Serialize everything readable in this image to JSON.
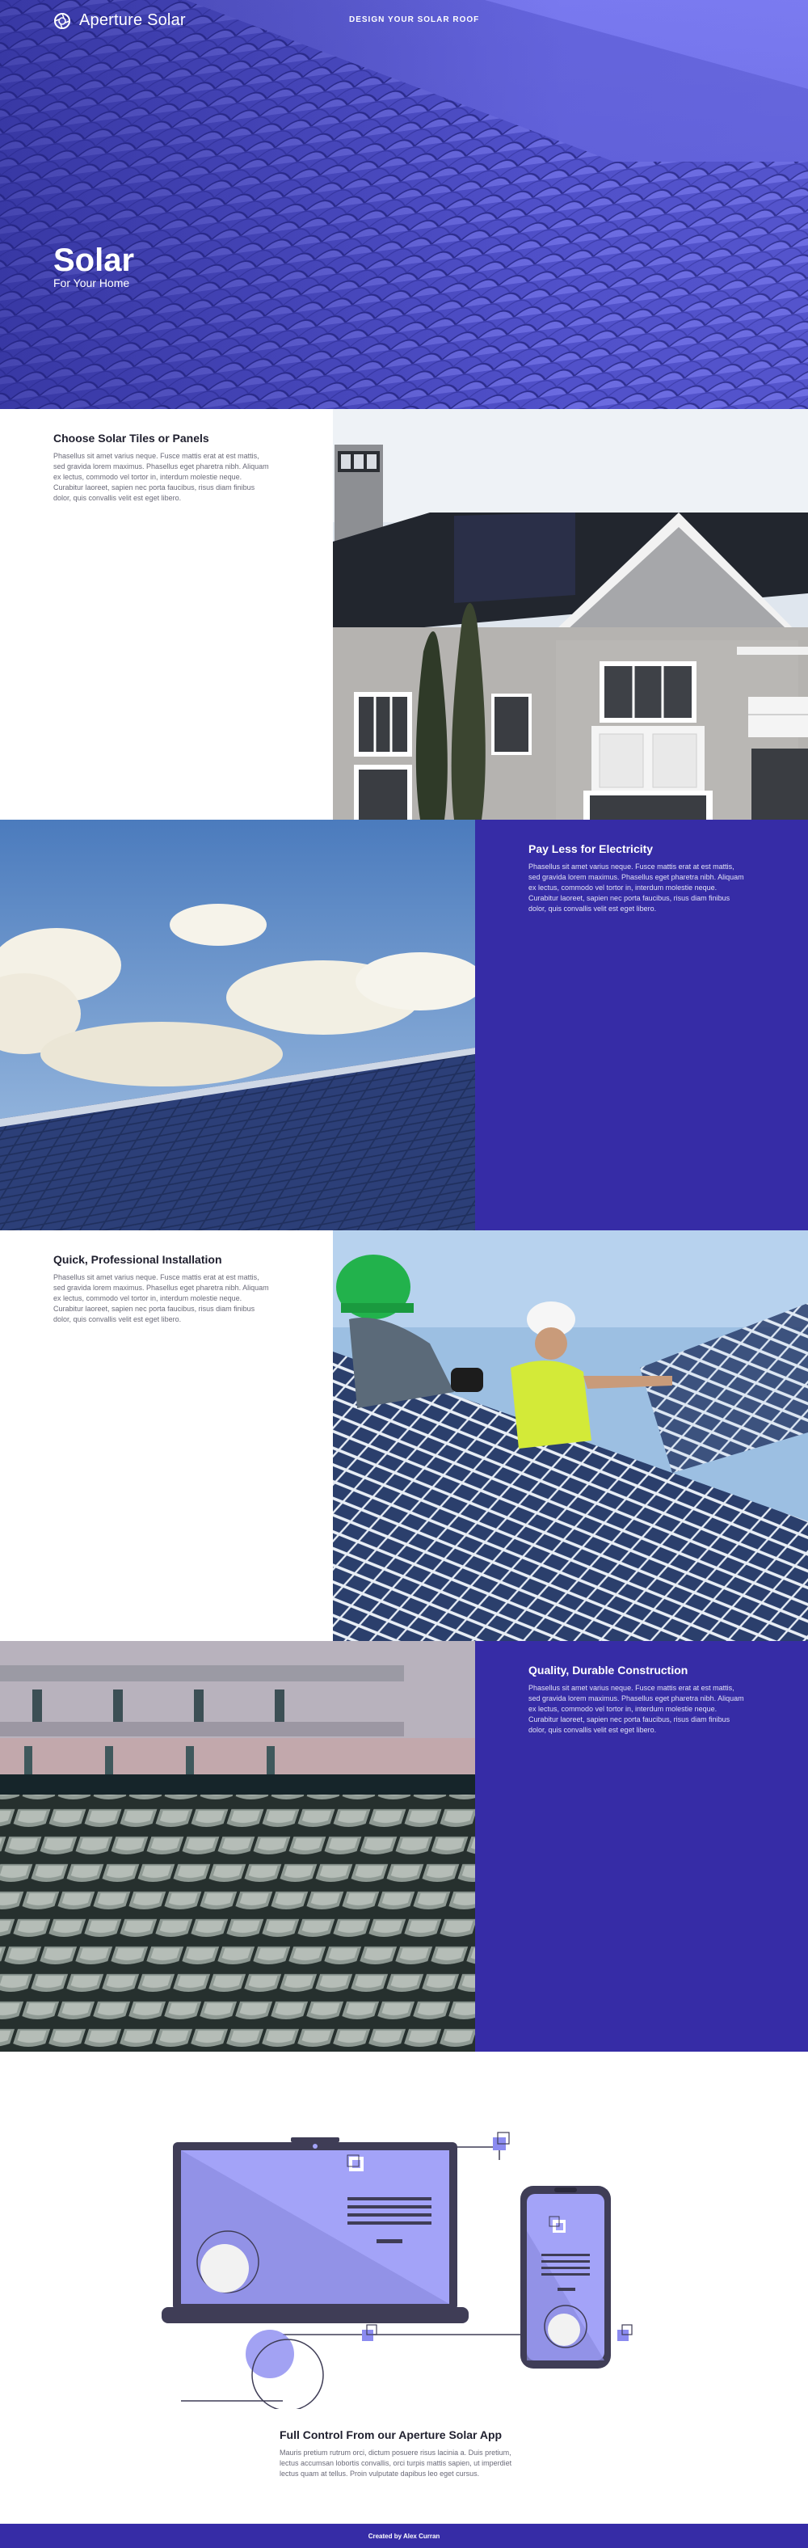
{
  "brand": {
    "name": "Aperture Solar",
    "accent": "#362ca6",
    "hero_tint": "#6d6de6"
  },
  "nav": {
    "cta": "DESIGN YOUR SOLAR ROOF"
  },
  "hero": {
    "title": "Solar",
    "subtitle": "For Your Home"
  },
  "features": [
    {
      "title": "Choose Solar Tiles or Panels",
      "body": "Phasellus sit amet varius neque. Fusce mattis erat at est mattis, sed gravida lorem maximus. Phasellus eget pharetra nibh. Aliquam ex lectus, commodo vel tortor in, interdum molestie neque. Curabitur laoreet, sapien nec porta faucibus, risus diam finibus dolor, quis convallis velit est eget libero."
    },
    {
      "title": "Pay Less for Electricity",
      "body": "Phasellus sit amet varius neque. Fusce mattis erat at est mattis, sed gravida lorem maximus. Phasellus eget pharetra nibh. Aliquam ex lectus, commodo vel tortor in, interdum molestie neque. Curabitur laoreet, sapien nec porta faucibus, risus diam finibus dolor, quis convallis velit est eget libero."
    },
    {
      "title": "Quick, Professional Installation",
      "body": "Phasellus sit amet varius neque. Fusce mattis erat at est mattis, sed gravida lorem maximus. Phasellus eget pharetra nibh. Aliquam ex lectus, commodo vel tortor in, interdum molestie neque. Curabitur laoreet, sapien nec porta faucibus, risus diam finibus dolor, quis convallis velit est eget libero."
    },
    {
      "title": "Quality, Durable Construction",
      "body": "Phasellus sit amet varius neque. Fusce mattis erat at est mattis, sed gravida lorem maximus. Phasellus eget pharetra nibh. Aliquam ex lectus, commodo vel tortor in, interdum molestie neque. Curabitur laoreet, sapien nec porta faucibus, risus diam finibus dolor, quis convallis velit est eget libero."
    }
  ],
  "app": {
    "title": "Full Control From our Aperture Solar App",
    "body": "Mauris pretium rutrum orci, dictum posuere risus lacinia a. Duis pretium, lectus accumsan lobortis convallis, orci turpis mattis sapien, ut imperdiet lectus quam at tellus. Proin vulputate dapibus leo eget cursus."
  },
  "footer": {
    "text": "Created by Alex Curran"
  }
}
